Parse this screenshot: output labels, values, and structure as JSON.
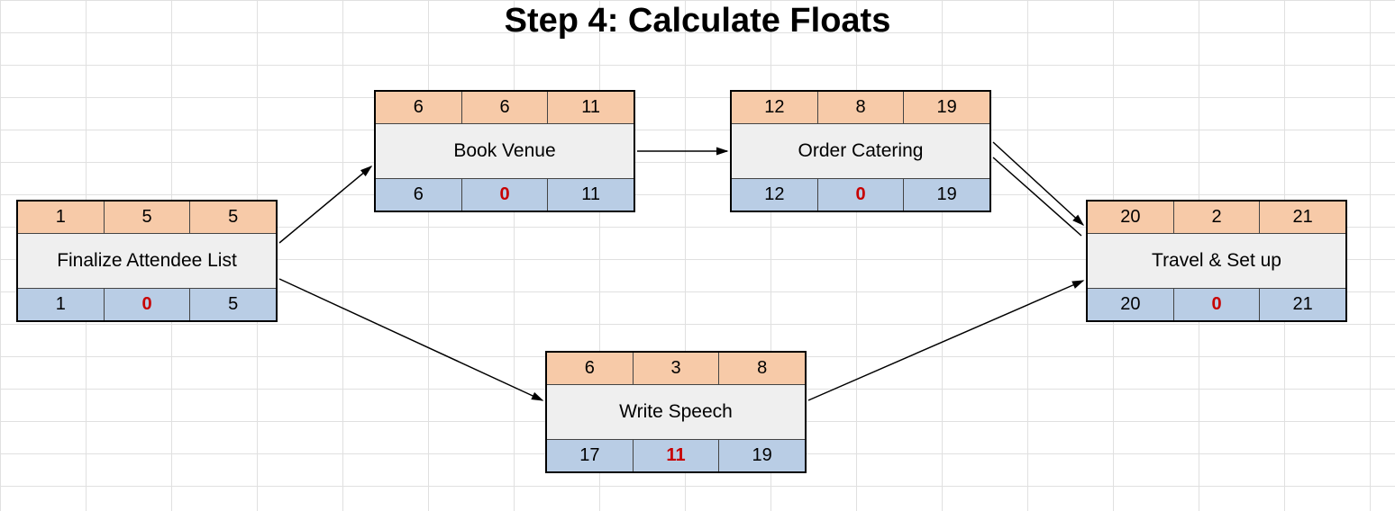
{
  "title": "Step 4:  Calculate Floats",
  "chart_data": {
    "type": "diagram",
    "description": "Activity-on-node precedence (CPM) network showing ES/D/EF (top), activity name (middle), LS/float/LF (bottom).",
    "nodes": [
      {
        "id": "A",
        "name": "Finalize Attendee List",
        "es": 1,
        "d": 5,
        "ef": 5,
        "ls": 1,
        "float": 0,
        "lf": 5
      },
      {
        "id": "B",
        "name": "Book Venue",
        "es": 6,
        "d": 6,
        "ef": 11,
        "ls": 6,
        "float": 0,
        "lf": 11
      },
      {
        "id": "C",
        "name": "Order Catering",
        "es": 12,
        "d": 8,
        "ef": 19,
        "ls": 12,
        "float": 0,
        "lf": 19
      },
      {
        "id": "D",
        "name": "Write Speech",
        "es": 6,
        "d": 3,
        "ef": 8,
        "ls": 17,
        "float": 11,
        "lf": 19
      },
      {
        "id": "E",
        "name": "Travel & Set up",
        "es": 20,
        "d": 2,
        "ef": 21,
        "ls": 20,
        "float": 0,
        "lf": 21
      }
    ],
    "edges": [
      [
        "A",
        "B"
      ],
      [
        "A",
        "D"
      ],
      [
        "B",
        "C"
      ],
      [
        "C",
        "E"
      ],
      [
        "D",
        "E"
      ]
    ]
  }
}
